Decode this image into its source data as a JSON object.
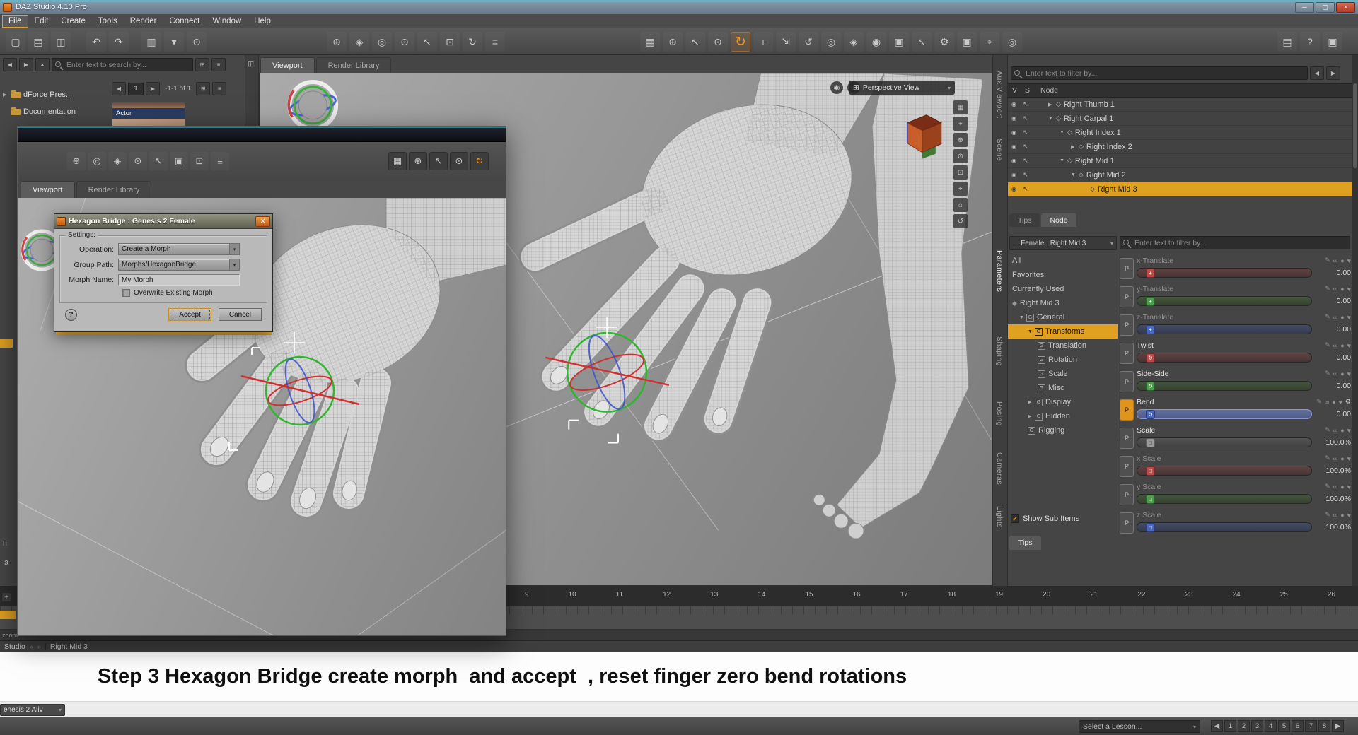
{
  "icons": {
    "caret": "▾",
    "minimize": "─",
    "maximize": "▢",
    "close": "×",
    "grid": "⊞",
    "menu": "≡",
    "left_arrow": "◀",
    "right_arrow": "▶",
    "up_arrow": "▲",
    "check": "✔",
    "breadcrumb": "»",
    "eye": "◉",
    "cursor": "↖",
    "bone": "◇",
    "pencil": "✎",
    "link": "∞",
    "lock": "●",
    "heart": "♥",
    "gear": "⚙",
    "help": "?",
    "camera_orb": "◉",
    "nav_orb": "⊕"
  },
  "titlebar": {
    "title": "DAZ Studio 4.10 Pro"
  },
  "menus": [
    {
      "label": "File",
      "active": true
    },
    {
      "label": "Edit"
    },
    {
      "label": "Create"
    },
    {
      "label": "Tools"
    },
    {
      "label": "Render"
    },
    {
      "label": "Connect"
    },
    {
      "label": "Window"
    },
    {
      "label": "Help"
    }
  ],
  "toolbar": {
    "g1": [
      {
        "name": "new-scene",
        "glyph": "▢"
      },
      {
        "name": "open-scene",
        "glyph": "▤"
      },
      {
        "name": "save-scene",
        "glyph": "◫"
      }
    ],
    "g2": [
      {
        "name": "undo",
        "glyph": "↶"
      },
      {
        "name": "redo",
        "glyph": "↷"
      }
    ],
    "g3": [
      {
        "name": "layout-options",
        "glyph": "▥"
      },
      {
        "name": "style-selector",
        "glyph": "▾"
      },
      {
        "name": "scene-search",
        "glyph": "⊙"
      }
    ],
    "g4": [
      {
        "name": "create-figure",
        "glyph": "⊕"
      },
      {
        "name": "pose-tool",
        "glyph": "◈"
      },
      {
        "name": "effects-tool",
        "glyph": "◎"
      },
      {
        "name": "environment-tool",
        "glyph": "⊙"
      },
      {
        "name": "wand-tool",
        "glyph": "↖"
      },
      {
        "name": "transform-box-tool",
        "glyph": "⊡"
      },
      {
        "name": "rotate-box-tool",
        "glyph": "↻"
      },
      {
        "name": "list-options",
        "glyph": "≡"
      }
    ],
    "g5": [
      {
        "name": "grid-snap",
        "glyph": "▦"
      },
      {
        "name": "joint-editor",
        "glyph": "⊕"
      },
      {
        "name": "pointer-tool",
        "glyph": "↖"
      },
      {
        "name": "rotate-tool",
        "glyph": "⊙"
      },
      {
        "name": "active-rotate-tool",
        "glyph": "↻",
        "active": true
      },
      {
        "name": "translate-tool",
        "glyph": "+"
      },
      {
        "name": "scale-tool",
        "glyph": "⇲"
      },
      {
        "name": "twist-tool",
        "glyph": "↺"
      },
      {
        "name": "surface-selection-tool",
        "glyph": "◎"
      },
      {
        "name": "geometry-editor-tool",
        "glyph": "◈"
      },
      {
        "name": "mesh-grabber-tool",
        "glyph": "◉"
      },
      {
        "name": "view-cube-tool",
        "glyph": "▣"
      },
      {
        "name": "node-selection-tool",
        "glyph": "↖"
      },
      {
        "name": "tool-settings",
        "glyph": "⚙"
      },
      {
        "name": "camera-tool",
        "glyph": "▣"
      },
      {
        "name": "aim-tool",
        "glyph": "⌖"
      },
      {
        "name": "spot-render-tool",
        "glyph": "◎"
      }
    ],
    "g6": [
      {
        "name": "image-editor",
        "glyph": "▤"
      },
      {
        "name": "interactive-help",
        "glyph": "?"
      },
      {
        "name": "render-settings",
        "glyph": "▣"
      }
    ]
  },
  "left_panel": {
    "search_placeholder": "Enter text to search by...",
    "tree_items": [
      {
        "label": "dForce Pres...",
        "arrow": "▶"
      },
      {
        "label": "Documentation",
        "arrow": ""
      }
    ],
    "pager_value": "1",
    "pager_range": "-1-1 of 1",
    "thumbnail_label": "Actor"
  },
  "viewport": {
    "tabs": [
      {
        "label": "Viewport",
        "active": true
      },
      {
        "label": "Render Library"
      }
    ],
    "view_selector": "Perspective View",
    "side_icons": [
      {
        "name": "view-cube",
        "glyph": "▦"
      },
      {
        "name": "pan-view",
        "glyph": "+"
      },
      {
        "name": "dolly-view",
        "glyph": "⊕"
      },
      {
        "name": "orbit-view",
        "glyph": "⊙"
      },
      {
        "name": "frame-view",
        "glyph": "⊡"
      },
      {
        "name": "aim-view",
        "glyph": "⌖"
      },
      {
        "name": "home-view",
        "glyph": "⌂"
      },
      {
        "name": "reset-view",
        "glyph": "↺"
      }
    ]
  },
  "float_window": {
    "tabs": [
      {
        "label": "Viewport",
        "active": true
      },
      {
        "label": "Render Library"
      }
    ],
    "toolbar_icons": [
      {
        "name": "create-figure",
        "glyph": "⊕"
      },
      {
        "name": "fit-tool",
        "glyph": "◎"
      },
      {
        "name": "magnet-tool",
        "glyph": "◈"
      },
      {
        "name": "environment-tool",
        "glyph": "⊙"
      },
      {
        "name": "wand-tool",
        "glyph": "↖"
      },
      {
        "name": "camera-tool",
        "glyph": "▣"
      },
      {
        "name": "frame-tool",
        "glyph": "⊡"
      },
      {
        "name": "list-options",
        "glyph": "≡"
      }
    ],
    "tool_icons": [
      {
        "name": "grid-snap",
        "glyph": "▦"
      },
      {
        "name": "sphere-tool",
        "glyph": "⊕"
      },
      {
        "name": "pointer-tool",
        "glyph": "↖"
      },
      {
        "name": "orbit-tool",
        "glyph": "⊙"
      },
      {
        "name": "active-rotate-tool",
        "glyph": "↻",
        "active": true
      }
    ]
  },
  "dialog": {
    "title": "Hexagon Bridge : Genesis 2 Female",
    "settings_label": "Settings:",
    "operation_label": "Operation:",
    "operation_value": "Create a Morph",
    "group_path_label": "Group Path:",
    "group_path_value": "Morphs/HexagonBridge",
    "morph_name_label": "Morph Name:",
    "morph_name_value": "My Morph",
    "overwrite_label": "Overwrite Existing Morph",
    "help_label": "?",
    "accept_label": "Accept",
    "cancel_label": "Cancel"
  },
  "scene": {
    "filter_placeholder": "Enter text to filter by...",
    "columns": {
      "v": "V",
      "s": "S",
      "node": "Node"
    },
    "nodes": [
      {
        "label": "Right Thumb 1",
        "indent": 2,
        "arrow": "▶"
      },
      {
        "label": "Right Carpal 1",
        "indent": 2,
        "arrow": "▼"
      },
      {
        "label": "Right Index 1",
        "indent": 3,
        "arrow": "▼"
      },
      {
        "label": "Right Index 2",
        "indent": 4,
        "arrow": "▶"
      },
      {
        "label": "Right Mid 1",
        "indent": 3,
        "arrow": "▼"
      },
      {
        "label": "Right Mid 2",
        "indent": 4,
        "arrow": "▼"
      },
      {
        "label": "Right Mid 3",
        "indent": 5,
        "arrow": "",
        "selected": true
      }
    ]
  },
  "params": {
    "tabs": [
      {
        "label": "Tips"
      },
      {
        "label": "Node",
        "active": true
      }
    ],
    "selector": "... Female : Right Mid 3",
    "filter_placeholder": "Enter text to filter by...",
    "categories": [
      {
        "label": "All",
        "indent": 0
      },
      {
        "label": "Favorites",
        "indent": 0
      },
      {
        "label": "Currently Used",
        "indent": 0
      },
      {
        "label": "Right Mid 3",
        "indent": 0,
        "glyph": "◆",
        "dim": true
      },
      {
        "label": "General",
        "indent": 1,
        "arrow": "▼",
        "icon": "G"
      },
      {
        "label": "Transforms",
        "indent": 2,
        "arrow": "▼",
        "icon": "G",
        "selected": true
      },
      {
        "label": "Translation",
        "indent": 3,
        "icon": "G"
      },
      {
        "label": "Rotation",
        "indent": 3,
        "icon": "G"
      },
      {
        "label": "Scale",
        "indent": 3,
        "icon": "G"
      },
      {
        "label": "Misc",
        "indent": 3,
        "icon": "G"
      },
      {
        "label": "Display",
        "indent": 2,
        "arrow": "▶",
        "icon": "G",
        "dim": true
      },
      {
        "label": "Hidden",
        "indent": 2,
        "arrow": "▶",
        "icon": "G",
        "dim": true
      },
      {
        "label": "Rigging",
        "indent": 2,
        "icon": "G"
      }
    ],
    "show_sub_items": "Show Sub Items",
    "bottom_tab": "Tips",
    "sliders": [
      {
        "name": "x-Translate",
        "value": "0.00",
        "color": "red",
        "dim": true,
        "knob": "+"
      },
      {
        "name": "y-Translate",
        "value": "0.00",
        "color": "green",
        "dim": true,
        "knob": "+"
      },
      {
        "name": "z-Translate",
        "value": "0.00",
        "color": "blue",
        "dim": true,
        "knob": "+"
      },
      {
        "name": "Twist",
        "value": "0.00",
        "color": "red",
        "knob": "↻"
      },
      {
        "name": "Side-Side",
        "value": "0.00",
        "color": "green",
        "knob": "↻"
      },
      {
        "name": "Bend",
        "value": "0.00",
        "color": "blue",
        "highlighted": true,
        "gear": true,
        "knob": "↻"
      },
      {
        "name": "Scale",
        "value": "100.0%",
        "color": "gray",
        "knob": "□"
      },
      {
        "name": "x Scale",
        "value": "100.0%",
        "color": "red",
        "dim": true,
        "knob": "□"
      },
      {
        "name": "y Scale",
        "value": "100.0%",
        "color": "green",
        "dim": true,
        "knob": "□"
      },
      {
        "name": "z Scale",
        "value": "100.0%",
        "color": "blue",
        "dim": true,
        "knob": "□"
      }
    ]
  },
  "side_tabs": [
    {
      "label": "Aux Viewport"
    },
    {
      "label": "Scene"
    },
    {
      "label": "Parameters",
      "active": true
    },
    {
      "label": "Shaping"
    },
    {
      "label": "Posing"
    },
    {
      "label": "Cameras"
    },
    {
      "label": "Lights"
    }
  ],
  "timeline": {
    "ticks": [
      9,
      10,
      11,
      12,
      13,
      14,
      15,
      16,
      17,
      18,
      19,
      20,
      21,
      22,
      23,
      24,
      25,
      26
    ]
  },
  "fragments": {
    "timeline_tab": "Ti",
    "letter": "a",
    "zoom": "zoom",
    "plus": "+"
  },
  "statusbar": {
    "app": "Studio",
    "node": "Right Mid 3"
  },
  "caption": "Step 3 Hexagon Bridge create morph  and accept  , reset finger zero bend rotations",
  "genesis_dropdown": "enesis 2 Aliv",
  "bottom_bar": {
    "lesson": "Select a Lesson...",
    "pages": [
      "◀",
      "1",
      "2",
      "3",
      "4",
      "5",
      "6",
      "7",
      "8",
      "▶"
    ]
  },
  "colors": {
    "accent_orange": "#e8a020",
    "select_yellow": "#e0a020",
    "axis_red": "#c24848",
    "axis_green": "#48a048",
    "axis_blue": "#4868c8"
  }
}
